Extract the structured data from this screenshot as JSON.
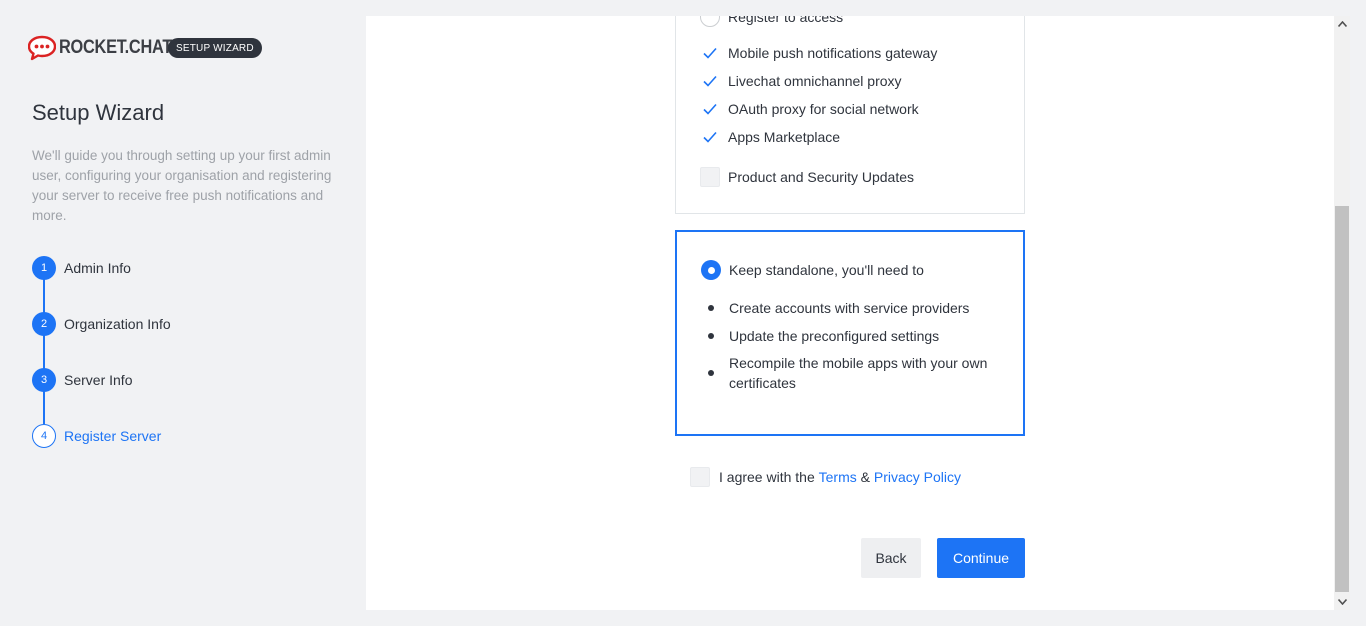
{
  "brand": {
    "name": "ROCKET.CHAT",
    "badge": "SETUP WIZARD",
    "color": "#db2323"
  },
  "sidebar": {
    "title": "Setup Wizard",
    "description": "We'll guide you through setting up your first admin user, configuring your organisation and registering your server to receive free push notifications and more.",
    "steps": [
      {
        "number": "1",
        "label": "Admin Info"
      },
      {
        "number": "2",
        "label": "Organization Info"
      },
      {
        "number": "3",
        "label": "Server Info"
      },
      {
        "number": "4",
        "label": "Register Server"
      }
    ],
    "current_step": 4
  },
  "register_card": {
    "option_label": "Register to access",
    "features": [
      "Mobile push notifications gateway",
      "Livechat omnichannel proxy",
      "OAuth proxy for social network",
      "Apps Marketplace"
    ],
    "updates_label": "Product and Security Updates"
  },
  "standalone_card": {
    "option_label": "Keep standalone, you'll need to",
    "items": [
      "Create accounts with service providers",
      "Update the preconfigured settings",
      "Recompile the mobile apps with your own certificates"
    ]
  },
  "agree": {
    "prefix": "I agree with the",
    "terms": "Terms",
    "ampersand": "&",
    "privacy": "Privacy Policy"
  },
  "buttons": {
    "back": "Back",
    "continue": "Continue"
  },
  "colors": {
    "accent": "#1d74f5",
    "text": "#2f343d",
    "muted": "#9ea2a8"
  }
}
